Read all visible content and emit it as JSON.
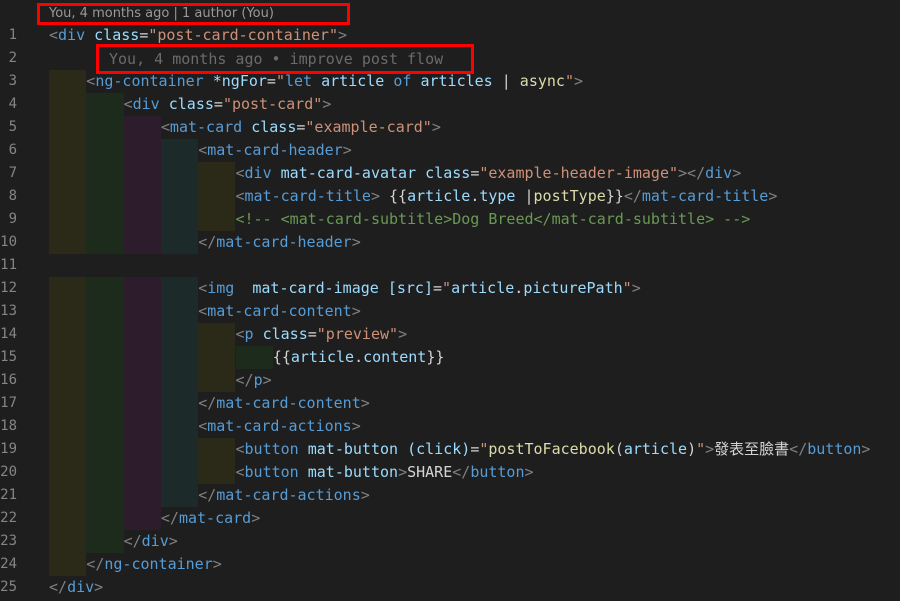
{
  "codelens": {
    "text": "You, 4 months ago | 1 author (You)"
  },
  "inline_blame": {
    "text": "You, 4 months ago • improve post flow"
  },
  "line_numbers": [
    "1",
    "2",
    "3",
    "4",
    "5",
    "6",
    "7",
    "8",
    "9",
    "10",
    "11",
    "12",
    "13",
    "14",
    "15",
    "16",
    "17",
    "18",
    "19",
    "20",
    "21",
    "22",
    "23",
    "24",
    "25"
  ],
  "colors": {
    "background": "#1e1e1e",
    "tag": "#569cd6",
    "attribute": "#9cdcfe",
    "string": "#ce9178",
    "comment": "#6a9955",
    "highlight": "#ff0000"
  },
  "lines": [
    {
      "indent": 0,
      "tokens": [
        [
          "p",
          "<"
        ],
        [
          "t",
          "div"
        ],
        [
          "w",
          " "
        ],
        [
          "a",
          "class"
        ],
        [
          "w",
          "="
        ],
        [
          "s",
          "\"post-card-container\""
        ],
        [
          "p",
          ">"
        ]
      ]
    },
    {
      "indent": 0,
      "tokens": []
    },
    {
      "indent": 1,
      "tokens": [
        [
          "p",
          "<"
        ],
        [
          "t",
          "ng-container"
        ],
        [
          "w",
          " "
        ],
        [
          "a",
          "*ngFor"
        ],
        [
          "w",
          "="
        ],
        [
          "s",
          "\""
        ],
        [
          "t",
          "let"
        ],
        [
          "w",
          " "
        ],
        [
          "a",
          "article"
        ],
        [
          "w",
          " "
        ],
        [
          "t",
          "of"
        ],
        [
          "w",
          " "
        ],
        [
          "a",
          "articles"
        ],
        [
          "w",
          " | "
        ],
        [
          "y",
          "async"
        ],
        [
          "s",
          "\""
        ],
        [
          "p",
          ">"
        ]
      ]
    },
    {
      "indent": 2,
      "tokens": [
        [
          "p",
          "<"
        ],
        [
          "t",
          "div"
        ],
        [
          "w",
          " "
        ],
        [
          "a",
          "class"
        ],
        [
          "w",
          "="
        ],
        [
          "s",
          "\"post-card\""
        ],
        [
          "p",
          ">"
        ]
      ]
    },
    {
      "indent": 3,
      "tokens": [
        [
          "p",
          "<"
        ],
        [
          "t",
          "mat-card"
        ],
        [
          "w",
          " "
        ],
        [
          "a",
          "class"
        ],
        [
          "w",
          "="
        ],
        [
          "s",
          "\"example-card\""
        ],
        [
          "p",
          ">"
        ]
      ]
    },
    {
      "indent": 4,
      "tokens": [
        [
          "p",
          "<"
        ],
        [
          "t",
          "mat-card-header"
        ],
        [
          "p",
          ">"
        ]
      ]
    },
    {
      "indent": 5,
      "tokens": [
        [
          "p",
          "<"
        ],
        [
          "t",
          "div"
        ],
        [
          "w",
          " "
        ],
        [
          "a",
          "mat-card-avatar"
        ],
        [
          "w",
          " "
        ],
        [
          "a",
          "class"
        ],
        [
          "w",
          "="
        ],
        [
          "s",
          "\"example-header-image\""
        ],
        [
          "p",
          "></"
        ],
        [
          "t",
          "div"
        ],
        [
          "p",
          ">"
        ]
      ]
    },
    {
      "indent": 5,
      "tokens": [
        [
          "p",
          "<"
        ],
        [
          "t",
          "mat-card-title"
        ],
        [
          "p",
          ">"
        ],
        [
          "w",
          " {{"
        ],
        [
          "a",
          "article"
        ],
        [
          "w",
          "."
        ],
        [
          "a",
          "type"
        ],
        [
          "w",
          " |"
        ],
        [
          "y",
          "postType"
        ],
        [
          "w",
          "}}"
        ],
        [
          "p",
          "</"
        ],
        [
          "t",
          "mat-card-title"
        ],
        [
          "p",
          ">"
        ]
      ]
    },
    {
      "indent": 5,
      "tokens": [
        [
          "c",
          "<!-- <mat-card-subtitle>Dog Breed</mat-card-subtitle> -->"
        ]
      ]
    },
    {
      "indent": 4,
      "tokens": [
        [
          "p",
          "</"
        ],
        [
          "t",
          "mat-card-header"
        ],
        [
          "p",
          ">"
        ]
      ]
    },
    {
      "indent": 0,
      "tokens": []
    },
    {
      "indent": 4,
      "tokens": [
        [
          "p",
          "<"
        ],
        [
          "t",
          "img"
        ],
        [
          "w",
          "  "
        ],
        [
          "a",
          "mat-card-image"
        ],
        [
          "w",
          " "
        ],
        [
          "a",
          "[src]"
        ],
        [
          "w",
          "="
        ],
        [
          "s",
          "\""
        ],
        [
          "a",
          "article"
        ],
        [
          "w",
          "."
        ],
        [
          "a",
          "picturePath"
        ],
        [
          "s",
          "\""
        ],
        [
          "p",
          ">"
        ]
      ]
    },
    {
      "indent": 4,
      "tokens": [
        [
          "p",
          "<"
        ],
        [
          "t",
          "mat-card-content"
        ],
        [
          "p",
          ">"
        ]
      ]
    },
    {
      "indent": 5,
      "tokens": [
        [
          "p",
          "<"
        ],
        [
          "t",
          "p"
        ],
        [
          "w",
          " "
        ],
        [
          "a",
          "class"
        ],
        [
          "w",
          "="
        ],
        [
          "s",
          "\"preview\""
        ],
        [
          "p",
          ">"
        ]
      ]
    },
    {
      "indent": 6,
      "tokens": [
        [
          "w",
          "{{"
        ],
        [
          "a",
          "article"
        ],
        [
          "w",
          "."
        ],
        [
          "a",
          "content"
        ],
        [
          "w",
          "}}"
        ]
      ]
    },
    {
      "indent": 5,
      "tokens": [
        [
          "p",
          "</"
        ],
        [
          "t",
          "p"
        ],
        [
          "p",
          ">"
        ]
      ]
    },
    {
      "indent": 4,
      "tokens": [
        [
          "p",
          "</"
        ],
        [
          "t",
          "mat-card-content"
        ],
        [
          "p",
          ">"
        ]
      ]
    },
    {
      "indent": 4,
      "tokens": [
        [
          "p",
          "<"
        ],
        [
          "t",
          "mat-card-actions"
        ],
        [
          "p",
          ">"
        ]
      ]
    },
    {
      "indent": 5,
      "tokens": [
        [
          "p",
          "<"
        ],
        [
          "t",
          "button"
        ],
        [
          "w",
          " "
        ],
        [
          "a",
          "mat-button"
        ],
        [
          "w",
          " "
        ],
        [
          "a",
          "(click)"
        ],
        [
          "w",
          "="
        ],
        [
          "s",
          "\""
        ],
        [
          "y",
          "postToFacebook"
        ],
        [
          "w",
          "("
        ],
        [
          "a",
          "article"
        ],
        [
          "w",
          ")"
        ],
        [
          "s",
          "\""
        ],
        [
          "p",
          ">"
        ],
        [
          "w",
          "發表至臉書"
        ],
        [
          "p",
          "</"
        ],
        [
          "t",
          "button"
        ],
        [
          "p",
          ">"
        ]
      ]
    },
    {
      "indent": 5,
      "tokens": [
        [
          "p",
          "<"
        ],
        [
          "t",
          "button"
        ],
        [
          "w",
          " "
        ],
        [
          "a",
          "mat-button"
        ],
        [
          "p",
          ">"
        ],
        [
          "w",
          "SHARE"
        ],
        [
          "p",
          "</"
        ],
        [
          "t",
          "button"
        ],
        [
          "p",
          ">"
        ]
      ]
    },
    {
      "indent": 4,
      "tokens": [
        [
          "p",
          "</"
        ],
        [
          "t",
          "mat-card-actions"
        ],
        [
          "p",
          ">"
        ]
      ]
    },
    {
      "indent": 3,
      "tokens": [
        [
          "p",
          "</"
        ],
        [
          "t",
          "mat-card"
        ],
        [
          "p",
          ">"
        ]
      ]
    },
    {
      "indent": 2,
      "tokens": [
        [
          "p",
          "</"
        ],
        [
          "t",
          "div"
        ],
        [
          "p",
          ">"
        ]
      ]
    },
    {
      "indent": 1,
      "tokens": [
        [
          "p",
          "</"
        ],
        [
          "t",
          "ng-container"
        ],
        [
          "p",
          ">"
        ]
      ]
    },
    {
      "indent": 0,
      "tokens": [
        [
          "p",
          "</"
        ],
        [
          "t",
          "div"
        ],
        [
          "p",
          ">"
        ]
      ]
    }
  ]
}
